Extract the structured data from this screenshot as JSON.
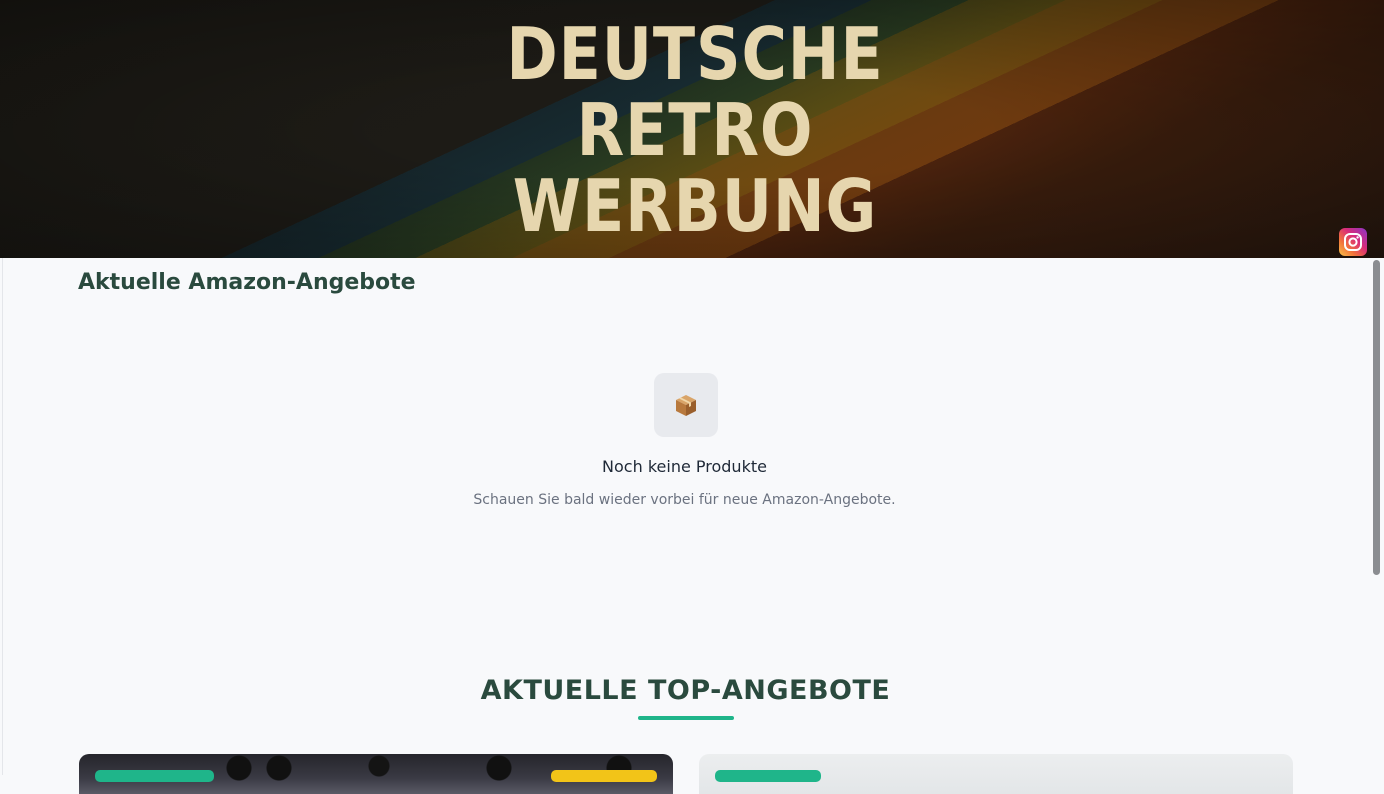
{
  "banner": {
    "title_lines": [
      "DEUTSCHE",
      "RETRO",
      "WERBUNG"
    ],
    "social_icon": "instagram-icon"
  },
  "main": {
    "section_title": "Aktuelle Amazon-Angebote",
    "empty_state": {
      "icon": "package-icon",
      "icon_glyph": "📦",
      "title": "Noch keine Produkte",
      "subtitle": "Schauen Sie bald wieder vorbei für neue Amazon-Angebote."
    },
    "top_offers": {
      "title": "AKTUELLE TOP-ANGEBOTE",
      "accent_color": "#1fb58a"
    }
  },
  "colors": {
    "heading": "#2a4a3e",
    "accent_green": "#1fb58a",
    "accent_yellow": "#f2c418"
  }
}
